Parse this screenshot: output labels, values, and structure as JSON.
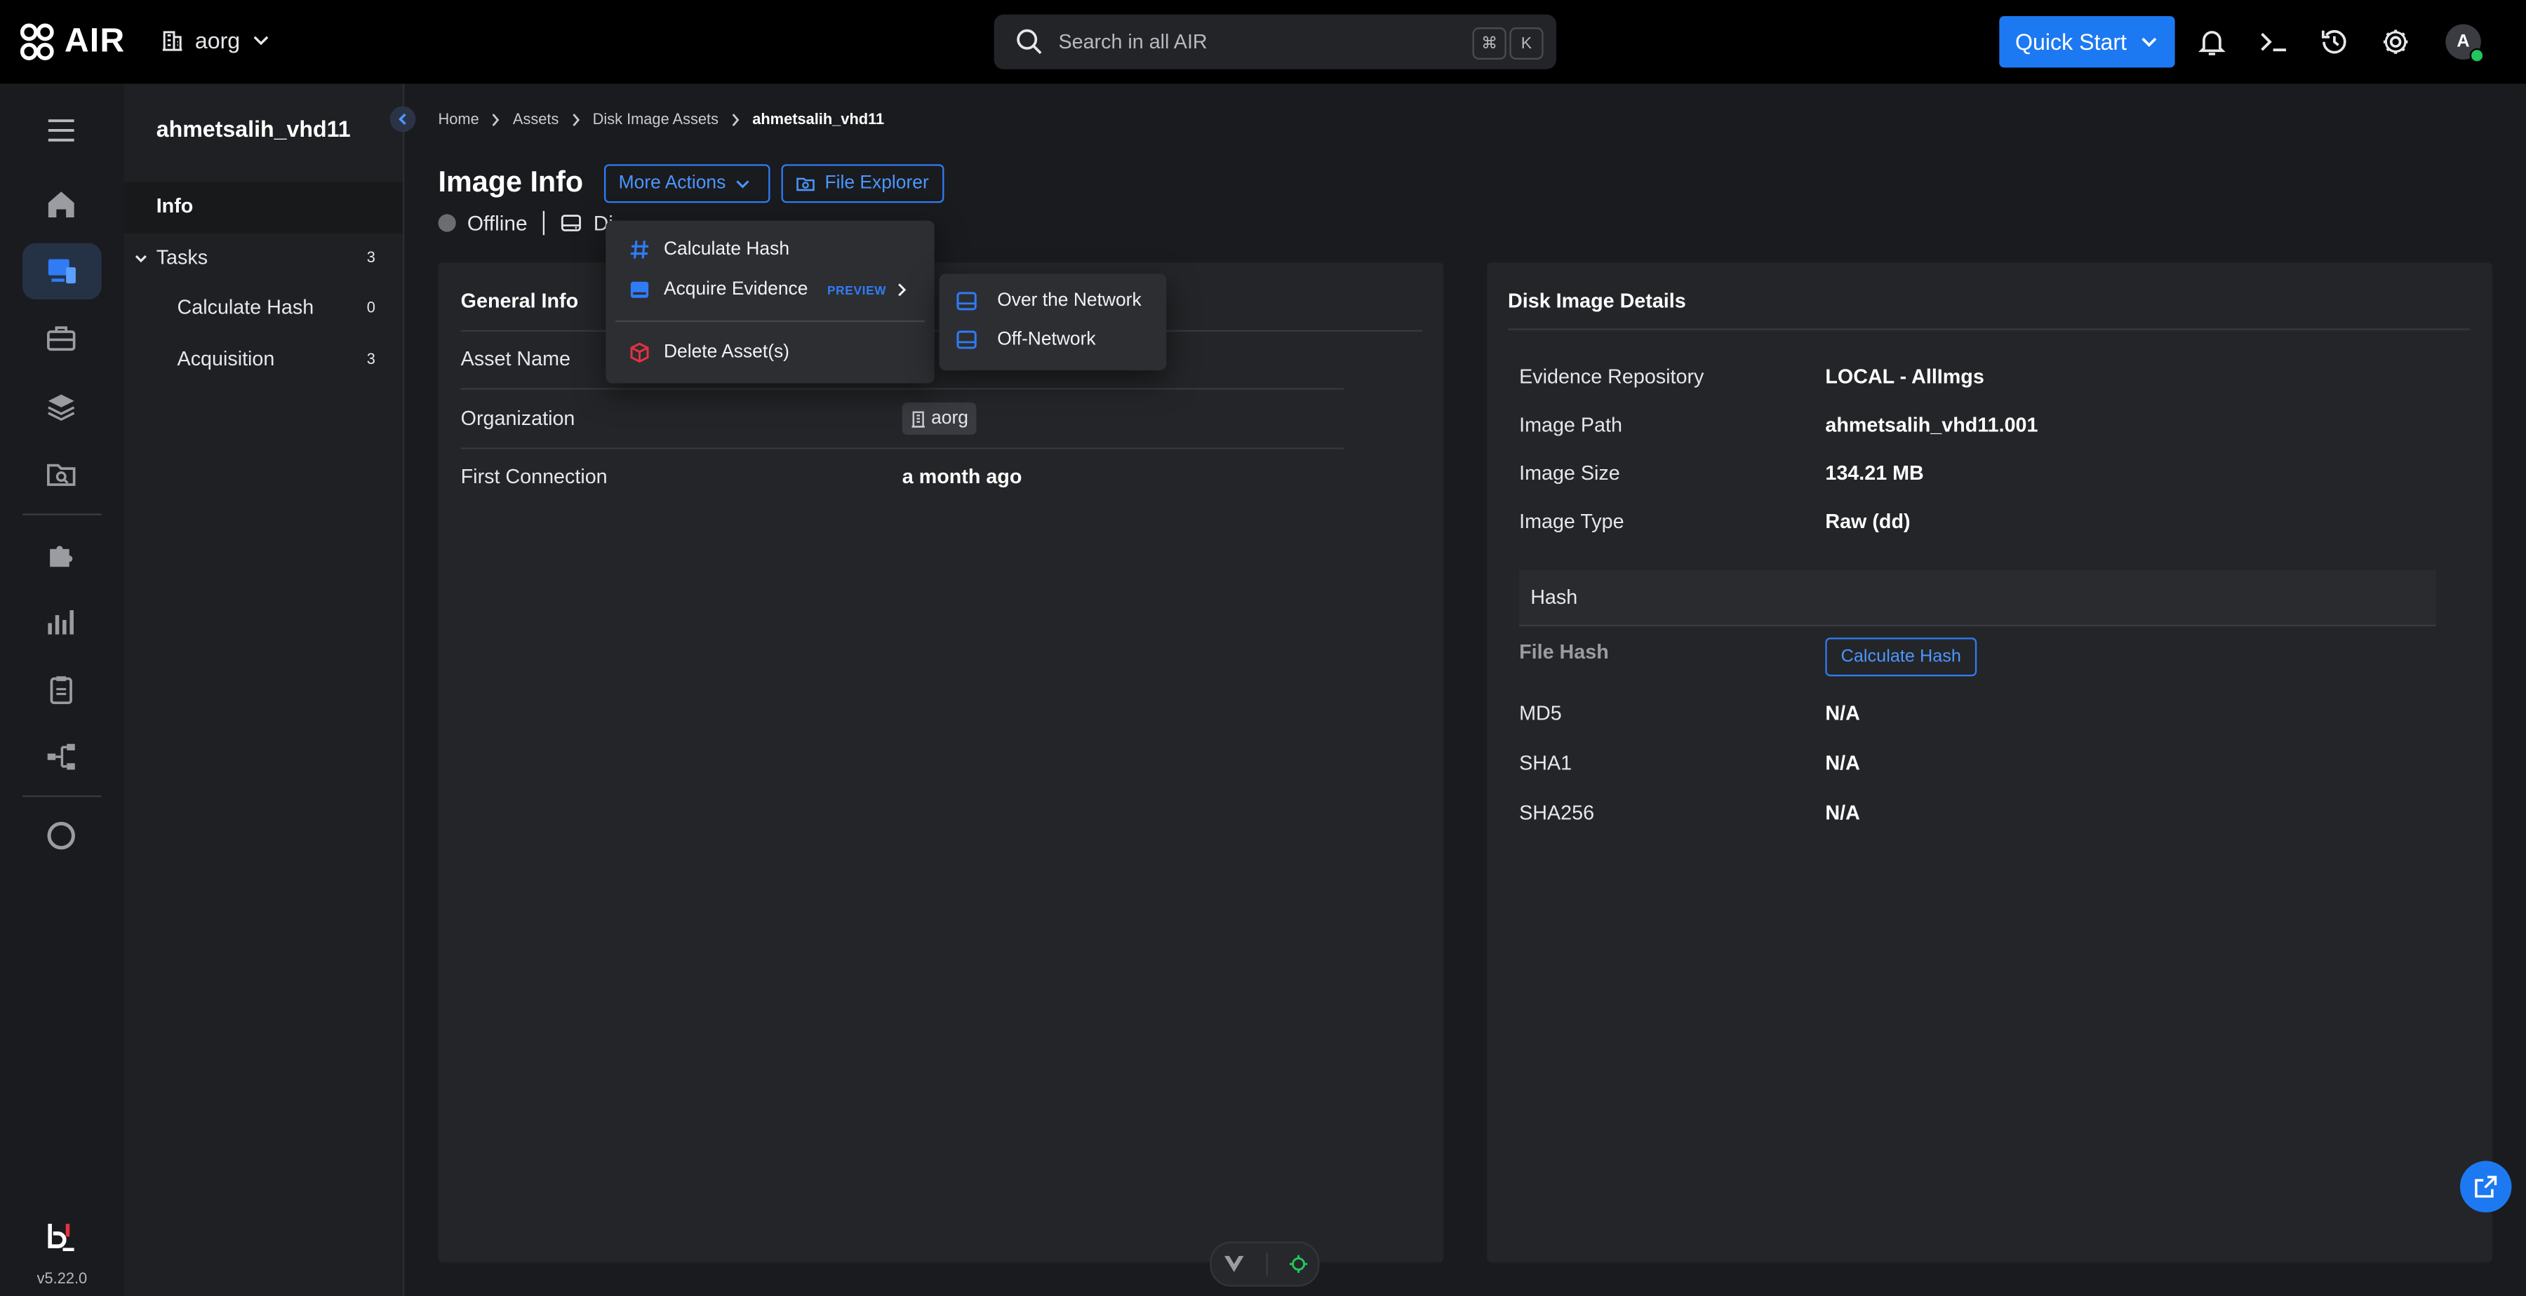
{
  "app": {
    "name": "AIR",
    "version": "v5.22.0"
  },
  "header": {
    "org": "aorg",
    "search_placeholder": "Search in all AIR",
    "kbd_cmd": "⌘",
    "kbd_k": "K",
    "quick_start": "Quick Start",
    "avatar_initial": "A"
  },
  "sidebar": {
    "asset_name": "ahmetsalih_vhd11",
    "info": "Info",
    "tasks": {
      "label": "Tasks",
      "count": "3"
    },
    "task_items": [
      {
        "label": "Calculate Hash",
        "count": "0"
      },
      {
        "label": "Acquisition",
        "count": "3"
      }
    ]
  },
  "breadcrumb": [
    "Home",
    "Assets",
    "Disk Image Assets",
    "ahmetsalih_vhd11"
  ],
  "page": {
    "title": "Image Info",
    "more_actions": "More Actions",
    "file_explorer": "File Explorer",
    "status": "Offline",
    "type_partial": "Di"
  },
  "general_info": {
    "title": "General Info",
    "rows": [
      {
        "label": "Asset Name",
        "value": ""
      },
      {
        "label": "Organization",
        "value": "aorg"
      },
      {
        "label": "First Connection",
        "value": "a month ago"
      }
    ]
  },
  "disk_image_details": {
    "title": "Disk Image Details",
    "rows": [
      {
        "label": "Evidence Repository",
        "value": "LOCAL - AllImgs"
      },
      {
        "label": "Image Path",
        "value": "ahmetsalih_vhd11.001"
      },
      {
        "label": "Image Size",
        "value": "134.21 MB"
      },
      {
        "label": "Image Type",
        "value": "Raw (dd)"
      }
    ],
    "hash_section": "Hash",
    "file_hash_label": "File Hash",
    "calculate_hash_button": "Calculate Hash",
    "hashes": [
      {
        "label": "MD5",
        "value": "N/A"
      },
      {
        "label": "SHA1",
        "value": "N/A"
      },
      {
        "label": "SHA256",
        "value": "N/A"
      }
    ]
  },
  "more_actions_menu": {
    "items": [
      {
        "label": "Calculate Hash",
        "icon": "hash-icon"
      },
      {
        "label": "Acquire Evidence",
        "icon": "drive-icon",
        "badge": "PREVIEW"
      },
      {
        "label": "Delete Asset(s)",
        "icon": "delete-icon"
      }
    ],
    "submenu": [
      {
        "label": "Over the Network",
        "icon": "drive-icon"
      },
      {
        "label": "Off-Network",
        "icon": "drive-icon"
      }
    ]
  },
  "colors": {
    "accent": "#1d79f2",
    "background": "#1a1b1e",
    "panel": "#242528",
    "status_online": "#22c55e",
    "delete": "#e5323f"
  }
}
